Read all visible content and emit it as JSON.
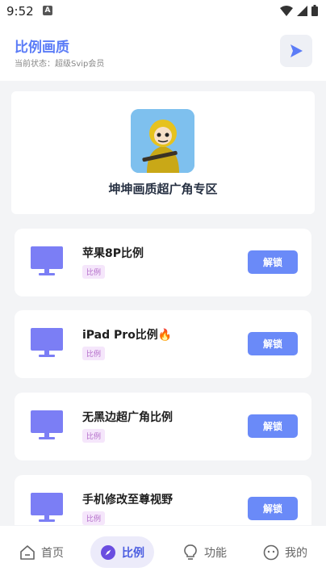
{
  "status_bar": {
    "time": "9:52"
  },
  "header": {
    "title": "比例画质",
    "subtitle": "当前状态：超级Svip会员"
  },
  "hero": {
    "title": "坤坤画质超广角专区"
  },
  "items": [
    {
      "name": "苹果8P比例",
      "tag": "比例",
      "button": "解锁"
    },
    {
      "name": "iPad Pro比例🔥",
      "tag": "比例",
      "button": "解锁"
    },
    {
      "name": "无黑边超广角比例",
      "tag": "比例",
      "button": "解锁"
    },
    {
      "name": "手机修改至尊视野",
      "tag": "比例",
      "button": "解锁"
    }
  ],
  "nav": [
    {
      "label": "首页",
      "icon": "home-icon",
      "active": false
    },
    {
      "label": "比例",
      "icon": "compass-icon",
      "active": true
    },
    {
      "label": "功能",
      "icon": "lightbulb-icon",
      "active": false
    },
    {
      "label": "我的",
      "icon": "face-icon",
      "active": false
    }
  ],
  "colors": {
    "accent": "#5b7cf7",
    "button": "#6a8af8",
    "monitor": "#7b7ef5",
    "tag_bg": "#f5e6fb",
    "tag_text": "#b36bc9"
  }
}
